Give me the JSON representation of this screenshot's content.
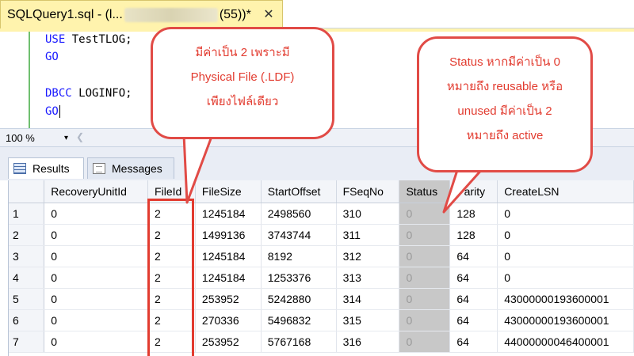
{
  "tab": {
    "title_prefix": "SQLQuery1.sql - (l...",
    "title_suffix": "(55))*",
    "close_glyph": "✕"
  },
  "editor": {
    "lines": [
      {
        "keyword": "USE",
        "rest": " TestTLOG;"
      },
      {
        "keyword": "GO",
        "rest": ""
      },
      {
        "keyword": "DBCC",
        "rest": " LOGINFO;"
      },
      {
        "keyword": "GO",
        "rest": ""
      }
    ]
  },
  "zoom": {
    "value": "100 %",
    "arrow": "▾"
  },
  "results_tabs": {
    "results": "Results",
    "messages": "Messages"
  },
  "grid": {
    "columns": [
      "RecoveryUnitId",
      "FileId",
      "FileSize",
      "StartOffset",
      "FSeqNo",
      "Status",
      "Parity",
      "CreateLSN"
    ],
    "rows": [
      [
        "1",
        "0",
        "2",
        "1245184",
        "2498560",
        "310",
        "0",
        "128",
        "0"
      ],
      [
        "2",
        "0",
        "2",
        "1499136",
        "3743744",
        "311",
        "0",
        "128",
        "0"
      ],
      [
        "3",
        "0",
        "2",
        "1245184",
        "8192",
        "312",
        "0",
        "64",
        "0"
      ],
      [
        "4",
        "0",
        "2",
        "1245184",
        "1253376",
        "313",
        "0",
        "64",
        "0"
      ],
      [
        "5",
        "0",
        "2",
        "253952",
        "5242880",
        "314",
        "0",
        "64",
        "43000000193600001"
      ],
      [
        "6",
        "0",
        "2",
        "270336",
        "5496832",
        "315",
        "0",
        "64",
        "43000000193600001"
      ],
      [
        "7",
        "0",
        "2",
        "253952",
        "5767168",
        "316",
        "0",
        "64",
        "44000000046400001"
      ]
    ]
  },
  "callouts": {
    "left": [
      "มีค่าเป็น 2 เพราะมี",
      "Physical File (.LDF)",
      "เพียงไฟล์เดียว"
    ],
    "right": [
      "Status หากมีค่าเป็น 0",
      "หมายถึง reusable หรือ",
      "unused มีค่าเป็น 2",
      "หมายถึง active"
    ]
  },
  "colors": {
    "callout_red": "#e23b2f",
    "tab_yellow": "#fff3ad",
    "status_gray": "#c8c8c8"
  }
}
